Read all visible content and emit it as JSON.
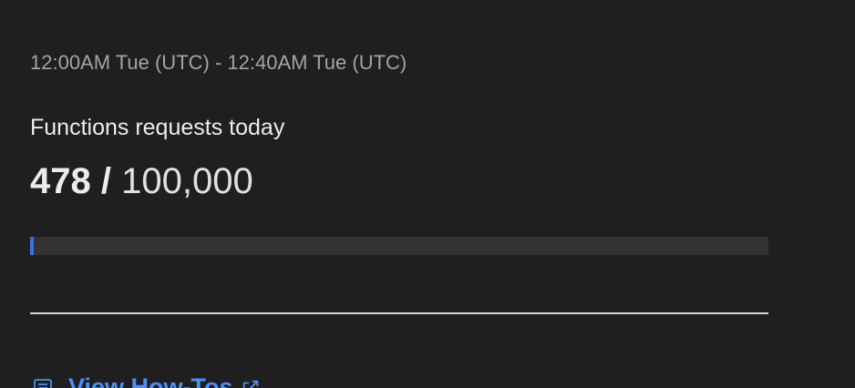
{
  "usage": {
    "time_range": "12:00AM Tue (UTC) - 12:40AM Tue (UTC)",
    "label": "Functions requests today",
    "used": "478",
    "separator": "/",
    "limit": "100,000",
    "progress_fraction": 0.00478
  },
  "link": {
    "label": "View How-Tos",
    "icon": "list-icon",
    "trailing_icon": "external-link-icon",
    "color": "#4c8ff5"
  },
  "colors": {
    "background": "#1f1f1f",
    "progress_fill": "#3b6fe6",
    "progress_track": "#333333"
  }
}
